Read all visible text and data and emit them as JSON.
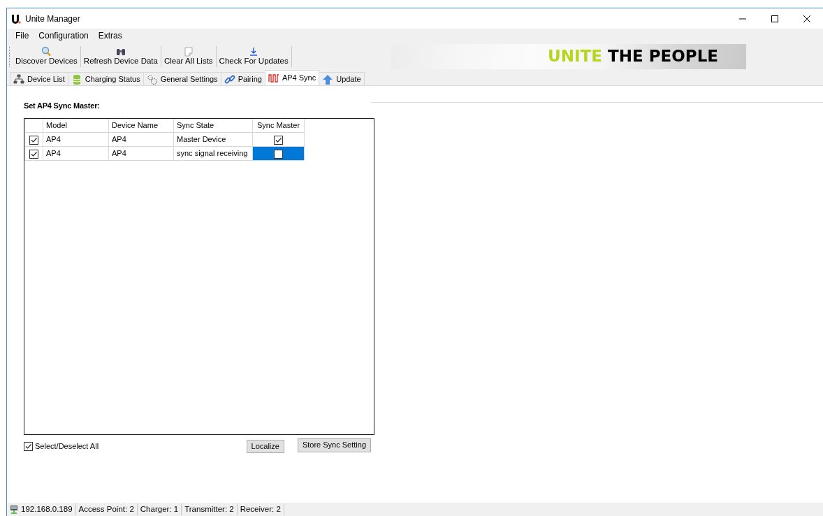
{
  "window": {
    "title": "Unite Manager"
  },
  "menu": [
    "File",
    "Configuration",
    "Extras"
  ],
  "toolbar": [
    "Discover Devices",
    "Refresh Device Data",
    "Clear All Lists",
    "Check For Updates"
  ],
  "banner": {
    "accent": "UNITE",
    "text": "THE PEOPLE"
  },
  "tabs": [
    {
      "label": "Device List",
      "selected": false
    },
    {
      "label": "Charging Status",
      "selected": false
    },
    {
      "label": "General Settings",
      "selected": false
    },
    {
      "label": "Pairing",
      "selected": false
    },
    {
      "label": "AP4 Sync",
      "selected": true
    },
    {
      "label": "Update",
      "selected": false
    }
  ],
  "panel": {
    "heading": "Set AP4 Sync Master:",
    "table": {
      "columns": [
        "Model",
        "Device Name",
        "Sync State",
        "Sync Master"
      ],
      "rows": [
        {
          "checked": true,
          "model": "AP4",
          "device_name": "AP4",
          "sync_state": "Master Device",
          "sync_master": true,
          "selected": false
        },
        {
          "checked": true,
          "model": "AP4",
          "device_name": "AP4",
          "sync_state": "sync signal receiving",
          "sync_master": false,
          "selected": true
        }
      ]
    },
    "select_all": {
      "label": "Select/Deselect All",
      "checked": true
    },
    "buttons": [
      "Localize",
      "Store Sync Setting"
    ]
  },
  "status_bar": [
    "192.168.0.189",
    "Access Point: 2",
    "Charger: 1",
    "Transmitter: 2",
    "Receiver: 2"
  ]
}
